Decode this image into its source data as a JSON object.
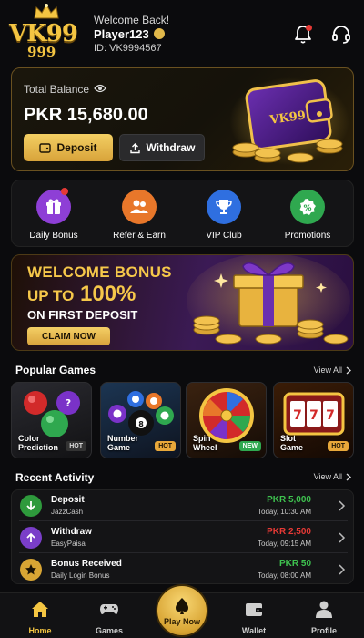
{
  "header": {
    "logo": "VK99",
    "logo_sub": "999",
    "welcome": "Welcome Back!",
    "player_name": "Player123",
    "player_id": "ID: VK9994567"
  },
  "balance": {
    "label": "Total Balance",
    "value": "PKR 15,680.00",
    "deposit_label": "Deposit",
    "withdraw_label": "Withdraw"
  },
  "quick_menu": [
    {
      "label": "Daily Bonus",
      "icon": "gift-icon",
      "color": "#8e3fd6",
      "notify": true
    },
    {
      "label": "Refer & Earn",
      "icon": "users-icon",
      "color": "#e8772a",
      "notify": false
    },
    {
      "label": "VIP Club",
      "icon": "trophy-icon",
      "color": "#2f6fe0",
      "notify": false
    },
    {
      "label": "Promotions",
      "icon": "percent-icon",
      "color": "#2fa84f",
      "notify": false
    }
  ],
  "promo": {
    "line1": "WELCOME BONUS",
    "line2_prefix": "UP TO",
    "line2_value": "100%",
    "line3": "ON FIRST DEPOSIT",
    "cta": "CLAIM NOW"
  },
  "popular_games": {
    "title": "Popular Games",
    "view_all": "View All",
    "items": [
      {
        "name_l1": "Color",
        "name_l2": "Prediction",
        "tag": "HOT"
      },
      {
        "name_l1": "Number",
        "name_l2": "Game",
        "tag": "HOT"
      },
      {
        "name_l1": "Spin",
        "name_l2": "Wheel",
        "tag": "NEW"
      },
      {
        "name_l1": "Slot",
        "name_l2": "Game",
        "tag": "HOT"
      }
    ]
  },
  "recent_activity": {
    "title": "Recent Activity",
    "view_all": "View All",
    "items": [
      {
        "title": "Deposit",
        "sub": "JazzCash",
        "amount": "PKR 5,000",
        "amount_color": "#3ec24f",
        "time": "Today, 10:30 AM",
        "icon": "arrow-down-icon",
        "icon_color": "#2e9a3c"
      },
      {
        "title": "Withdraw",
        "sub": "EasyPaisa",
        "amount": "PKR 2,500",
        "amount_color": "#e53935",
        "time": "Today, 09:15 AM",
        "icon": "arrow-up-icon",
        "icon_color": "#7a3ec9"
      },
      {
        "title": "Bonus Received",
        "sub": "Daily Login Bonus",
        "amount": "PKR 50",
        "amount_color": "#3ec24f",
        "time": "Today, 08:00 AM",
        "icon": "star-icon",
        "icon_color": "#d8a534"
      }
    ]
  },
  "bottom_nav": {
    "home": "Home",
    "games": "Games",
    "play": "Play Now",
    "wallet": "Wallet",
    "profile": "Profile"
  }
}
